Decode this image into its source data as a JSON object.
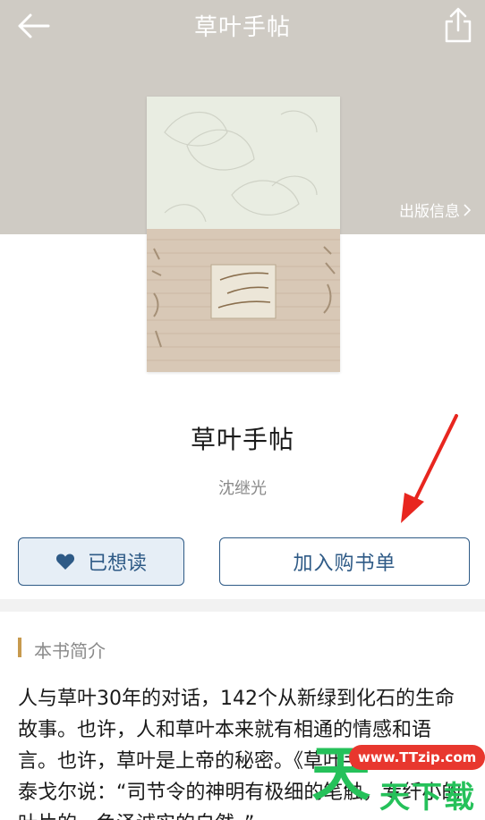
{
  "header": {
    "title": "草叶手帖",
    "back_icon": "arrow-left-icon",
    "share_icon": "share-icon",
    "pub_info_label": "出版信息",
    "background": "#cfcbc4"
  },
  "book": {
    "title": "草叶手帖",
    "author": "沈继光"
  },
  "actions": {
    "want_read_label": "已想读",
    "add_to_list_label": "加入购书单",
    "accent": "#2e5a86"
  },
  "intro": {
    "section_title": "本书简介",
    "text": "人与草叶30年的对话，142个从新绿到化石的生命故事。也许，人和草叶本来就有相通的情感和语言。也许，草叶是上帝的秘密。《草叶手帖》里—— 泰戈尔说：“司节令的神明有极细的笔触，专纤小的叶片的，色泽诚实的自然。”"
  },
  "watermark": {
    "pill": "www.TTzip.com",
    "big": "天",
    "small": "天下载"
  }
}
